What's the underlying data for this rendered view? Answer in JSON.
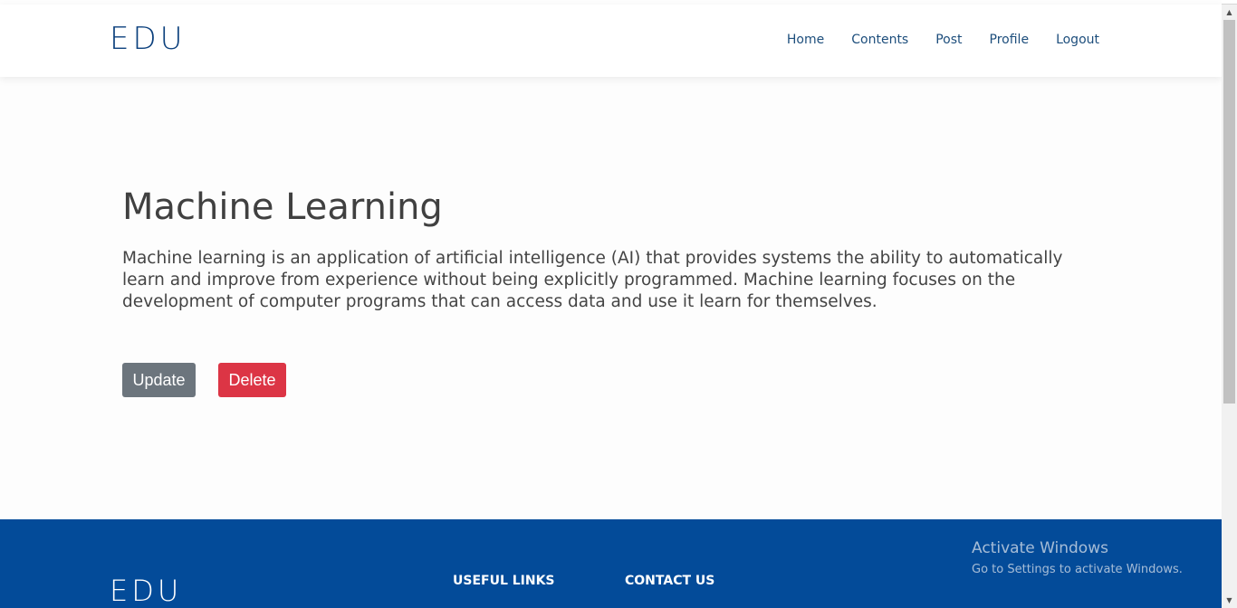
{
  "header": {
    "logo": "EDU",
    "nav": [
      {
        "label": "Home"
      },
      {
        "label": "Contents"
      },
      {
        "label": "Post"
      },
      {
        "label": "Profile"
      },
      {
        "label": "Logout"
      }
    ]
  },
  "content": {
    "title": "Machine Learning",
    "description": "Machine learning is an application of artificial intelligence (AI) that provides systems the ability to automatically learn and improve from experience without being explicitly programmed. Machine learning focuses on the development of computer programs that can access data and use it learn for themselves.",
    "update_label": "Update",
    "delete_label": "Delete"
  },
  "footer": {
    "logo": "EDU",
    "useful_links_heading": "USEFUL LINKS",
    "contact_heading": "CONTACT US"
  },
  "watermark": {
    "title": "Activate Windows",
    "subtitle": "Go to Settings to activate Windows."
  },
  "colors": {
    "brand": "#0a3f7c",
    "footer_bg": "#034b99",
    "update_btn": "#6c757d",
    "delete_btn": "#dc3545"
  }
}
